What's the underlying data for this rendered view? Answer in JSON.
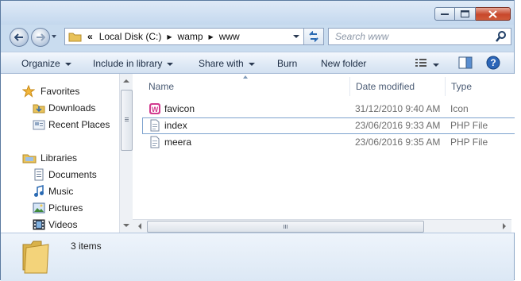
{
  "address": {
    "chevron": "«",
    "crumbs": [
      "Local Disk (C:)",
      "wamp",
      "www"
    ]
  },
  "search": {
    "placeholder": "Search www"
  },
  "toolbar": {
    "organize": "Organize",
    "include_in_library": "Include in library",
    "share_with": "Share with",
    "burn": "Burn",
    "new_folder": "New folder"
  },
  "nav": {
    "favorites": {
      "label": "Favorites",
      "items": [
        "Downloads",
        "Recent Places"
      ]
    },
    "libraries": {
      "label": "Libraries",
      "items": [
        "Documents",
        "Music",
        "Pictures",
        "Videos"
      ]
    }
  },
  "columns": {
    "name": "Name",
    "date_modified": "Date modified",
    "type": "Type"
  },
  "files": [
    {
      "name": "favicon",
      "date": "31/12/2010 9:40 AM",
      "type": "Icon",
      "icon": "wamp-icon"
    },
    {
      "name": "index",
      "date": "23/06/2016 9:33 AM",
      "type": "PHP File",
      "icon": "php-file-icon"
    },
    {
      "name": "meera",
      "date": "23/06/2016 9:35 AM",
      "type": "PHP File",
      "icon": "php-file-icon"
    }
  ],
  "status": {
    "count": "3 items"
  },
  "colors": {
    "accent": "#3c7fb1",
    "selection_border": "#7da2ce",
    "close_button": "#c8472b"
  }
}
